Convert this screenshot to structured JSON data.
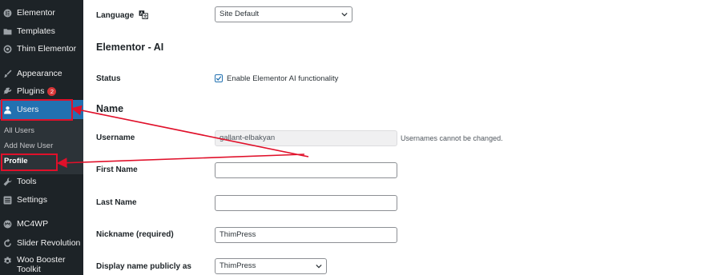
{
  "sidebar": {
    "items": [
      {
        "label": "Elementor",
        "icon": "elementor-icon"
      },
      {
        "label": "Templates",
        "icon": "folder-icon"
      },
      {
        "label": "Thim Elementor",
        "icon": "thim-icon"
      },
      {
        "label": "Appearance",
        "icon": "paintbrush-icon"
      },
      {
        "label": "Plugins",
        "icon": "plugin-icon",
        "badge": "2"
      },
      {
        "label": "Users",
        "icon": "user-icon"
      },
      {
        "label": "Tools",
        "icon": "wrench-icon"
      },
      {
        "label": "Settings",
        "icon": "settings-icon"
      },
      {
        "label": "MC4WP",
        "icon": "mc4wp-icon"
      },
      {
        "label": "Slider Revolution",
        "icon": "refresh-icon"
      },
      {
        "label": "Woo Booster",
        "label2": "Toolkit",
        "icon": "gear-icon"
      }
    ],
    "users_submenu": [
      "All Users",
      "Add New User",
      "Profile"
    ]
  },
  "form": {
    "language_label": "Language",
    "language_value": "Site Default",
    "elementor_ai_title": "Elementor - AI",
    "status_label": "Status",
    "status_checkbox_label": "Enable Elementor AI functionality",
    "status_checked": true,
    "name_title": "Name",
    "username_label": "Username",
    "username_value": "gallant-elbakyan",
    "username_hint": "Usernames cannot be changed.",
    "first_name_label": "First Name",
    "first_name_value": "",
    "last_name_label": "Last Name",
    "last_name_value": "",
    "nickname_label": "Nickname (required)",
    "nickname_value": "ThimPress",
    "display_name_label": "Display name publicly as",
    "display_name_value": "ThimPress"
  },
  "colors": {
    "sidebar_bg": "#1d2327",
    "active_menu": "#2271b1",
    "annotation_red": "#e0102a",
    "badge_red": "#d63638"
  }
}
